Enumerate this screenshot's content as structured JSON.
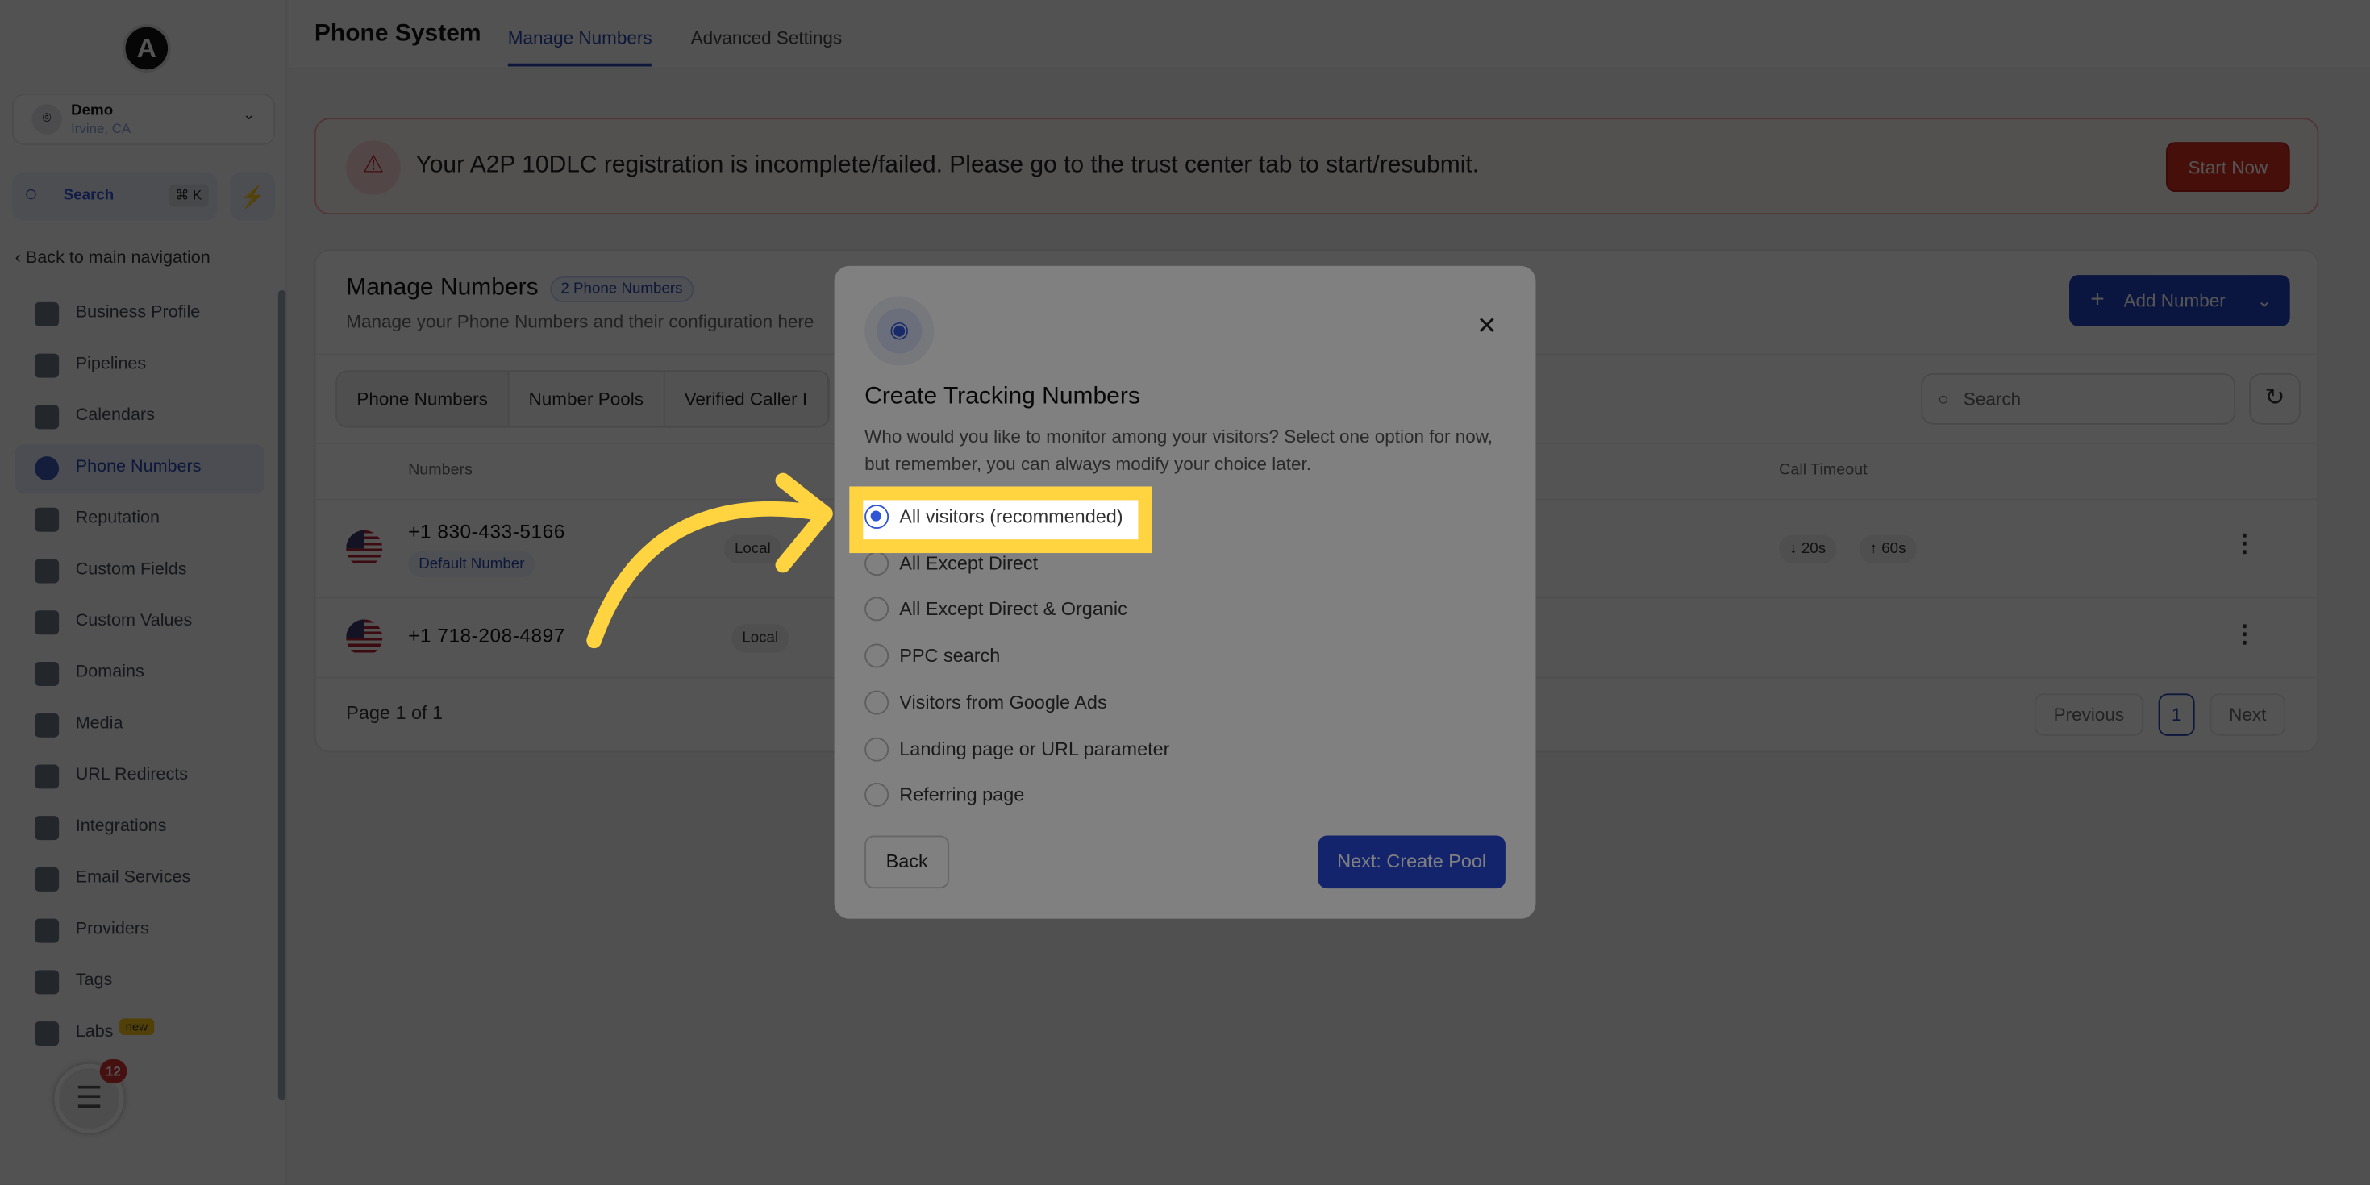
{
  "sidebar": {
    "logo_letter": "A",
    "location": {
      "name": "Demo",
      "city": "Irvine, CA"
    },
    "search": {
      "label": "Search",
      "shortcut": "⌘ K"
    },
    "back_label": "Back to main navigation",
    "items": [
      {
        "label": "Business Profile",
        "icon": "briefcase-icon"
      },
      {
        "label": "Pipelines",
        "icon": "funnel-icon"
      },
      {
        "label": "Calendars",
        "icon": "calendar-icon"
      },
      {
        "label": "Phone Numbers",
        "icon": "phone-icon",
        "active": true
      },
      {
        "label": "Reputation",
        "icon": "star-icon"
      },
      {
        "label": "Custom Fields",
        "icon": "fields-icon"
      },
      {
        "label": "Custom Values",
        "icon": "values-icon"
      },
      {
        "label": "Domains",
        "icon": "globe-icon"
      },
      {
        "label": "Media",
        "icon": "media-icon"
      },
      {
        "label": "URL Redirects",
        "icon": "redirect-icon"
      },
      {
        "label": "Integrations",
        "icon": "integrations-icon"
      },
      {
        "label": "Email Services",
        "icon": "email-icon"
      },
      {
        "label": "Providers",
        "icon": "providers-icon"
      },
      {
        "label": "Tags",
        "icon": "tag-icon"
      },
      {
        "label": "Labs",
        "icon": "flask-icon"
      }
    ],
    "labs_badge": "new",
    "chat_badge": "12"
  },
  "header": {
    "title": "Phone System",
    "tabs": [
      "Manage Numbers",
      "Advanced Settings"
    ]
  },
  "alert": {
    "text": "Your A2P 10DLC registration is incomplete/failed. Please go to the trust center tab to start/resubmit.",
    "button": "Start Now"
  },
  "card": {
    "title": "Manage Numbers",
    "badge": "2 Phone Numbers",
    "subtitle": "Manage your Phone Numbers and their configuration here",
    "add_button": "Add Number",
    "tabs": [
      "Phone Numbers",
      "Number Pools",
      "Verified Caller I"
    ],
    "search_placeholder": "Search",
    "columns": {
      "numbers": "Numbers",
      "call_timeout": "Call Timeout"
    },
    "rows": [
      {
        "number": "+1 830-433-5166",
        "badge": "Default Number",
        "type": "Local",
        "timeout_in": "20s",
        "timeout_out": "60s"
      },
      {
        "number": "+1 718-208-4897",
        "type": "Local"
      }
    ],
    "page_text": "Page 1 of 1",
    "pagination": {
      "previous": "Previous",
      "current": "1",
      "next": "Next"
    }
  },
  "modal": {
    "title": "Create Tracking Numbers",
    "description": "Who would you like to monitor among your visitors? Select one option for now, but remember, you can always modify your choice later.",
    "options": [
      "All visitors (recommended)",
      "All Except Direct",
      "All Except Direct & Organic",
      "PPC search",
      "Visitors from Google Ads",
      "Landing page or URL parameter",
      "Referring page"
    ],
    "selected": "All visitors (recommended)",
    "back": "Back",
    "next": "Next: Create Pool"
  },
  "colors": {
    "accent": "#2747d8",
    "highlight": "#ffd440",
    "alert": "#d42c1f"
  }
}
